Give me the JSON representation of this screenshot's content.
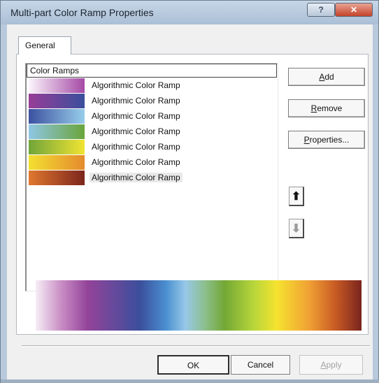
{
  "window": {
    "title": "Multi-part Color Ramp Properties"
  },
  "titlebar": {
    "help_label": "?",
    "close_label": "✕"
  },
  "tabs": [
    {
      "label": "General"
    }
  ],
  "list": {
    "header": "Color Ramps",
    "items": [
      {
        "label": "Algorithmic Color Ramp",
        "from_color": "#fbf4fb",
        "to_color": "#a54aa6"
      },
      {
        "label": "Algorithmic Color Ramp",
        "from_color": "#983d98",
        "to_color": "#3a4f9c"
      },
      {
        "label": "Algorithmic Color Ramp",
        "from_color": "#3c51a0",
        "to_color": "#97cdea"
      },
      {
        "label": "Algorithmic Color Ramp",
        "from_color": "#8fc6e6",
        "to_color": "#6aa53a"
      },
      {
        "label": "Algorithmic Color Ramp",
        "from_color": "#70a53a",
        "to_color": "#f1e432"
      },
      {
        "label": "Algorithmic Color Ramp",
        "from_color": "#f3e030",
        "to_color": "#e58a2e"
      },
      {
        "label": "Algorithmic Color Ramp",
        "from_color": "#e0782e",
        "to_color": "#7c251d"
      }
    ],
    "selected_index": 6
  },
  "buttons": {
    "add": {
      "pre": "",
      "key": "A",
      "post": "dd"
    },
    "remove": {
      "pre": "",
      "key": "R",
      "post": "emove"
    },
    "properties": {
      "pre": "",
      "key": "P",
      "post": "roperties..."
    },
    "ok": "OK",
    "cancel": "Cancel",
    "apply": {
      "pre": "",
      "key": "A",
      "post": "pply"
    }
  },
  "icons": {
    "move_up": "⬆",
    "move_down": "⬇"
  }
}
